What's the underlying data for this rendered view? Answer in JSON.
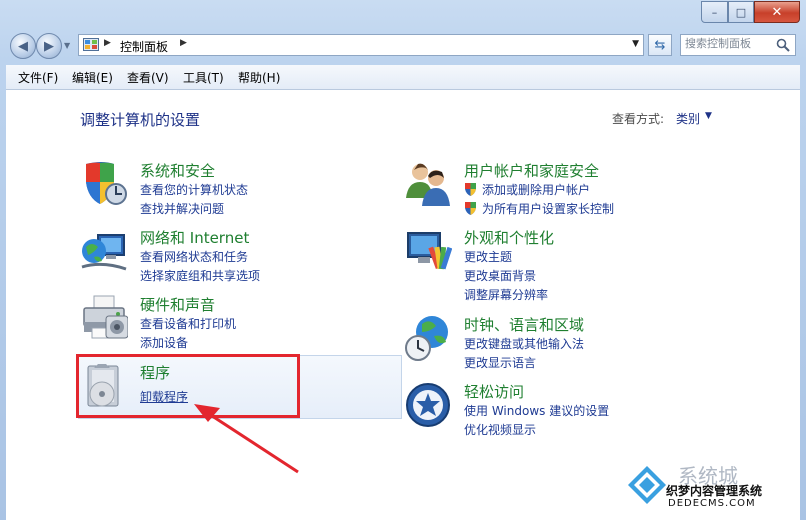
{
  "window": {
    "min": "–",
    "max": "□",
    "close": "✕"
  },
  "address": {
    "breadcrumb": "控制面板"
  },
  "search": {
    "placeholder": "搜索控制面板"
  },
  "menu": [
    "文件(F)",
    "编辑(E)",
    "查看(V)",
    "工具(T)",
    "帮助(H)"
  ],
  "main": {
    "title": "调整计算机的设置",
    "view_label": "查看方式:",
    "view_value": "类别"
  },
  "categories": {
    "system": {
      "title": "系统和安全",
      "links": [
        "查看您的计算机状态",
        "查找并解决问题"
      ]
    },
    "network": {
      "title": "网络和 Internet",
      "links": [
        "查看网络状态和任务",
        "选择家庭组和共享选项"
      ]
    },
    "hardware": {
      "title": "硬件和声音",
      "links": [
        "查看设备和打印机",
        "添加设备"
      ]
    },
    "programs": {
      "title": "程序",
      "links": [
        "卸载程序"
      ]
    },
    "users": {
      "title": "用户帐户和家庭安全",
      "links": [
        "添加或删除用户帐户",
        "为所有用户设置家长控制"
      ]
    },
    "appearance": {
      "title": "外观和个性化",
      "links": [
        "更改主题",
        "更改桌面背景",
        "调整屏幕分辨率"
      ]
    },
    "clock": {
      "title": "时钟、语言和区域",
      "links": [
        "更改键盘或其他输入法",
        "更改显示语言"
      ]
    },
    "ease": {
      "title": "轻松访问",
      "links": [
        "使用 Windows 建议的设置",
        "优化视频显示"
      ]
    }
  },
  "watermark": {
    "line1": "系统城",
    "line2": "织梦内容管理系统",
    "line3": "DEDECMS.COM"
  },
  "colors": {
    "category_title": "#1f7f30",
    "link": "#1f3b93",
    "highlight_border": "#e3262e",
    "page_title": "#1e3287"
  }
}
